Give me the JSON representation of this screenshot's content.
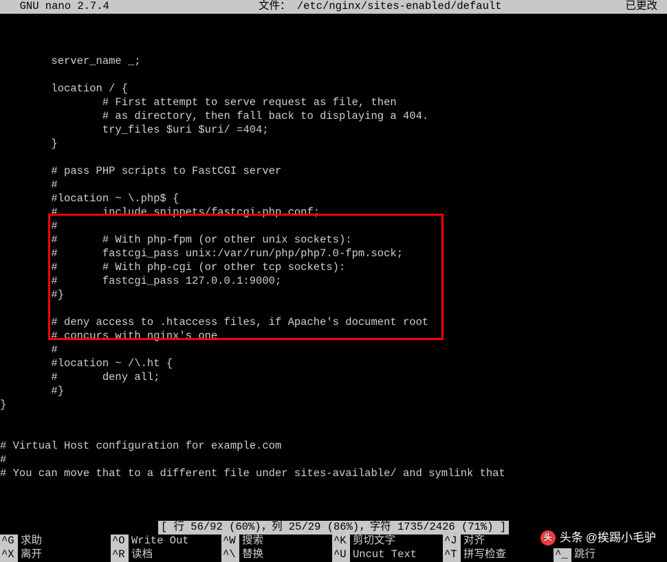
{
  "titlebar": {
    "app": "  GNU nano 2.7.4",
    "file_label": "文件：",
    "file_path": "/etc/nginx/sites-enabled/default",
    "modified": "已更改"
  },
  "editor": {
    "lines": [
      "",
      "",
      "",
      "        server_name _;",
      "",
      "        location / {",
      "                # First attempt to serve request as file, then",
      "                # as directory, then fall back to displaying a 404.",
      "                try_files $uri $uri/ =404;",
      "        }",
      "",
      "        # pass PHP scripts to FastCGI server",
      "        #",
      "        #location ~ \\.php$ {",
      "        #       include snippets/fastcgi-php.conf;",
      "        #",
      "        #       # With php-fpm (or other unix sockets):",
      "        #       fastcgi_pass unix:/var/run/php/php7.0-fpm.sock;",
      "        #       # With php-cgi (or other tcp sockets):",
      "        #       fastcgi_pass 127.0.0.1:9000;",
      "        #}",
      "",
      "        # deny access to .htaccess files, if Apache's document root",
      "        # concurs with nginx's one",
      "        #",
      "        #location ~ /\\.ht {",
      "        #       deny all;",
      "        #}",
      "}",
      "",
      "",
      "# Virtual Host configuration for example.com",
      "#",
      "# You can move that to a different file under sites-available/ and symlink that"
    ]
  },
  "status": {
    "text": "[ 行 56/92 (60%)，列 25/29 (86%)，字符 1735/2426 (71%) ]"
  },
  "shortcuts": {
    "row1": [
      {
        "key": "^G",
        "label": "求助"
      },
      {
        "key": "^O",
        "label": "Write Out"
      },
      {
        "key": "^W",
        "label": "搜索"
      },
      {
        "key": "^K",
        "label": "剪切文字"
      },
      {
        "key": "^J",
        "label": "对齐"
      }
    ],
    "row2": [
      {
        "key": "^X",
        "label": "离开"
      },
      {
        "key": "^R",
        "label": "读档"
      },
      {
        "key": "^\\",
        "label": "替换"
      },
      {
        "key": "^U",
        "label": "Uncut Text"
      },
      {
        "key": "^T",
        "label": "拼写检查"
      },
      {
        "key": "^_",
        "label": "跳行"
      }
    ]
  },
  "watermark": {
    "brand": "头条",
    "author": "@挨踢小毛驴"
  }
}
